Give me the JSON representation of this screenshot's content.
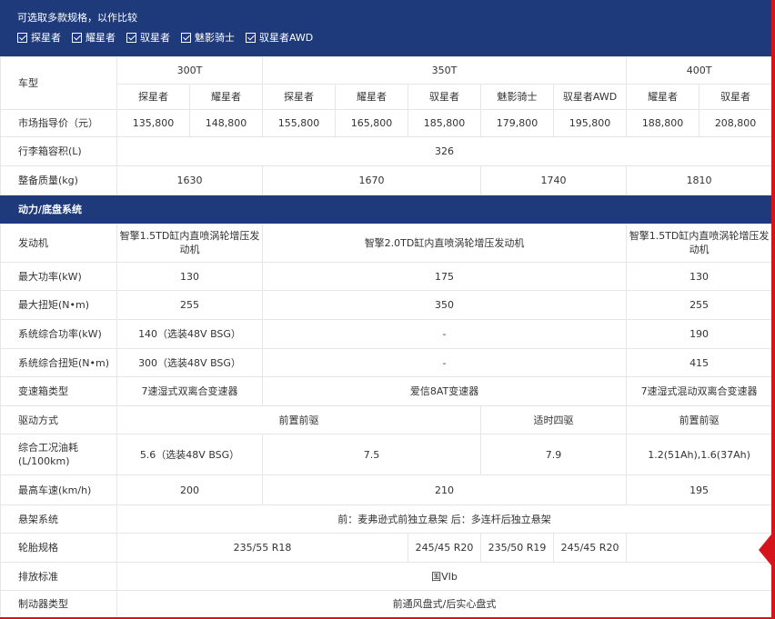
{
  "header": {
    "title": "可选取多款规格，以作比较",
    "filters": [
      "探星者",
      "耀星者",
      "驭星者",
      "魅影骑士",
      "驭星者AWD"
    ]
  },
  "rows": {
    "model_label": "车型",
    "groups": [
      "300T",
      "350T",
      "400T"
    ],
    "trims": [
      "探星者",
      "耀星者",
      "探星者",
      "耀星者",
      "驭星者",
      "魅影骑士",
      "驭星者AWD",
      "耀星者",
      "驭星者"
    ],
    "price_label": "市场指导价（元）",
    "prices": [
      "135,800",
      "148,800",
      "155,800",
      "165,800",
      "185,800",
      "179,800",
      "195,800",
      "188,800",
      "208,800"
    ],
    "trunk_label": "行李箱容积(L)",
    "trunk": "326",
    "weight_label": "整备质量(kg)",
    "weights": [
      "1630",
      "1670",
      "1740",
      "1810"
    ],
    "section_powertrain": "动力/底盘系统",
    "engine_label": "发动机",
    "engines": [
      "智擎1.5TD缸内直喷涡轮增压发动机",
      "智擎2.0TD缸内直喷涡轮增压发动机",
      "智擎1.5TD缸内直喷涡轮增压发动机"
    ],
    "power_label": "最大功率(kW)",
    "powers": [
      "130",
      "175",
      "130"
    ],
    "torque_label": "最大扭矩(N•m)",
    "torques": [
      "255",
      "350",
      "255"
    ],
    "sys_power_label": "系统综合功率(kW)",
    "sys_powers": [
      "140（选装48V BSG）",
      "-",
      "190"
    ],
    "sys_torque_label": "系统综合扭矩(N•m)",
    "sys_torques": [
      "300（选装48V BSG）",
      "-",
      "415"
    ],
    "trans_label": "变速箱类型",
    "trans": [
      "7速湿式双离合变速器",
      "爱信8AT变速器",
      "7速湿式混动双离合变速器"
    ],
    "drive_label": "驱动方式",
    "drives": [
      "前置前驱",
      "适时四驱",
      "前置前驱"
    ],
    "fuel_label": "综合工况油耗(L/100km)",
    "fuels": [
      "5.6（选装48V BSG）",
      "7.5",
      "7.9",
      "1.2(51Ah),1.6(37Ah)"
    ],
    "speed_label": "最高车速(km/h)",
    "speeds": [
      "200",
      "210",
      "195"
    ],
    "susp_label": "悬架系统",
    "susp": "前：麦弗逊式前独立悬架 后：多连杆后独立悬架",
    "tire_label": "轮胎规格",
    "tires": [
      "235/55 R18",
      "245/45 R20",
      "235/50 R19",
      "245/45 R20"
    ],
    "emission_label": "排放标准",
    "emission": "国VIb",
    "brake_label": "制动器类型",
    "brake": "前通风盘式/后实心盘式"
  }
}
